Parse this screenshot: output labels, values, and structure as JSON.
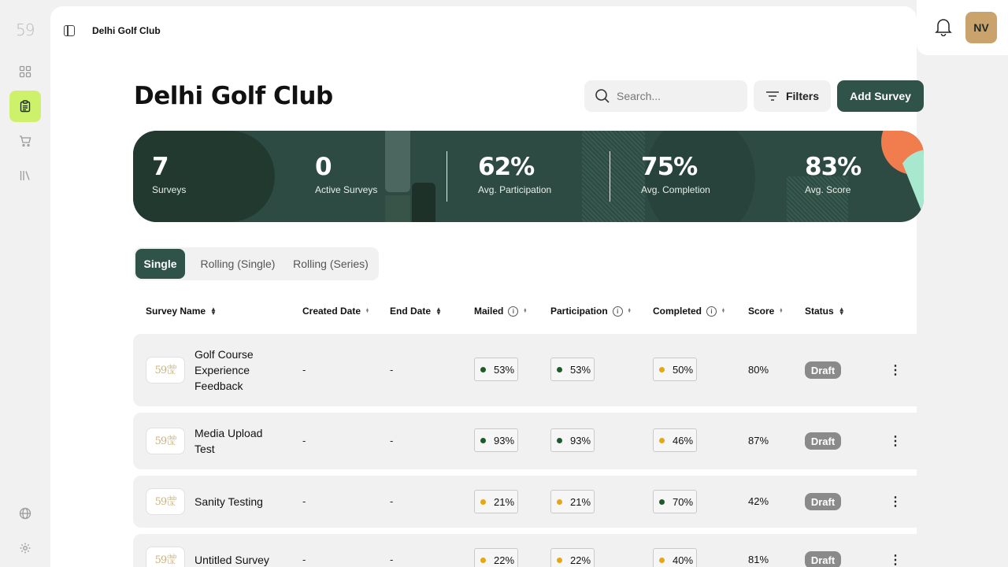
{
  "sidebar": {
    "logo": "59",
    "items": [
      {
        "name": "dashboard-icon"
      },
      {
        "name": "surveys-icon",
        "active": true
      },
      {
        "name": "cart-icon"
      },
      {
        "name": "library-icon"
      },
      {
        "name": "globe-icon"
      },
      {
        "name": "gear-icon"
      }
    ]
  },
  "header": {
    "breadcrumb": "Delhi Golf Club",
    "avatar_initials": "NV"
  },
  "page": {
    "title": "Delhi Golf Club",
    "search_placeholder": "Search...",
    "filters_label": "Filters",
    "add_label": "Add Survey"
  },
  "stats": [
    {
      "value": "7",
      "label": "Surveys"
    },
    {
      "value": "0",
      "label": "Active Surveys"
    },
    {
      "value": "62%",
      "label": "Avg. Participation"
    },
    {
      "value": "75%",
      "label": "Avg. Completion"
    },
    {
      "value": "83%",
      "label": "Avg. Score"
    }
  ],
  "tabs": [
    "Single",
    "Rolling (Single)",
    "Rolling (Series)"
  ],
  "table": {
    "columns": [
      "Survey Name",
      "Created Date",
      "End Date",
      "Mailed",
      "Participation",
      "Completed",
      "Score",
      "Status"
    ],
    "rows": [
      {
        "name": "Golf Course Experience Feedback",
        "created": "-",
        "end": "-",
        "mailed": "53%",
        "participation": "53%",
        "completed": "50%",
        "score": "80%",
        "status": "Draft"
      },
      {
        "name": "Media Upload Test",
        "created": "-",
        "end": "-",
        "mailed": "93%",
        "participation": "93%",
        "completed": "46%",
        "score": "87%",
        "status": "Draft"
      },
      {
        "name": "Sanity Testing",
        "created": "-",
        "end": "-",
        "mailed": "21%",
        "participation": "21%",
        "completed": "70%",
        "score": "42%",
        "status": "Draft"
      },
      {
        "name": "Untitled Survey",
        "created": "-",
        "end": "-",
        "mailed": "22%",
        "participation": "22%",
        "completed": "40%",
        "score": "81%",
        "status": "Draft"
      }
    ]
  },
  "thumb_logo": {
    "main": "59",
    "sub": "club",
    "sub2": "UK"
  },
  "colors": {
    "accent": "#2f5249",
    "nav_active": "#cdf16a",
    "dot_green": "#1f5a2a",
    "dot_amber": "#e3a814",
    "badge": "#8a8a8a"
  }
}
